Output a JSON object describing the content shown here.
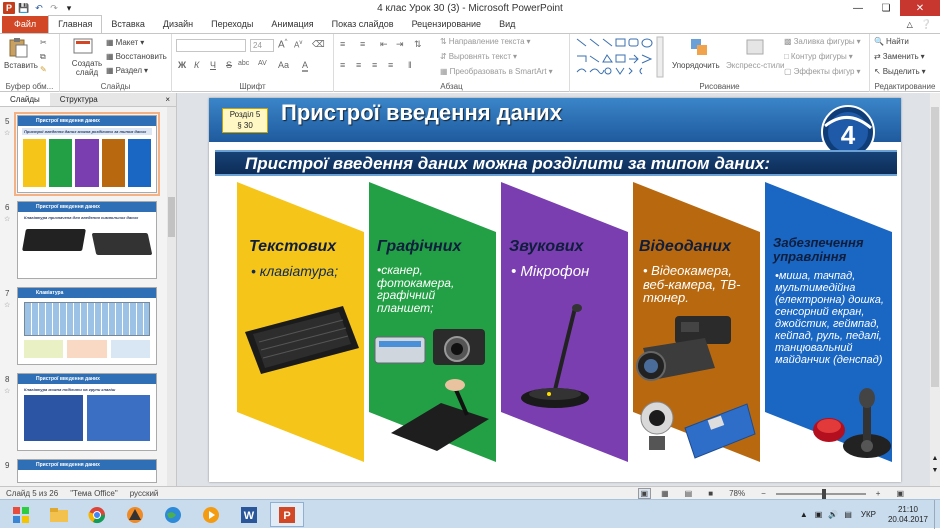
{
  "window": {
    "title": "4 клас Урок 30 (3)  -  Microsoft PowerPoint",
    "qat_logo": "P"
  },
  "tabs": [
    "Файл",
    "Главная",
    "Вставка",
    "Дизайн",
    "Переходы",
    "Анимация",
    "Показ слайдов",
    "Рецензирование",
    "Вид"
  ],
  "ribbon": {
    "clipboard": {
      "paste": "Вставить",
      "label": "Буфер обм..."
    },
    "slides": {
      "new_slide": "Создать слайд",
      "layout": "Макет",
      "reset": "Восстановить",
      "section": "Раздел",
      "label": "Слайды"
    },
    "font": {
      "size": "24",
      "label": "Шрифт",
      "bold": "Ж",
      "italic": "К",
      "underline": "Ч",
      "strike": "S",
      "shadow": "abc",
      "spacing": "AV",
      "case": "Aa",
      "color": "A"
    },
    "paragraph": {
      "text_dir": "Направление текста",
      "align": "Выровнять текст",
      "smartart": "Преобразовать в SmartArt",
      "label": "Абзац"
    },
    "drawing": {
      "arrange": "Упорядочить",
      "quick_styles": "Экспресс-стили",
      "fill": "Заливка фигуры",
      "outline": "Контур фигуры",
      "effects": "Эффекты фигур",
      "label": "Рисование"
    },
    "editing": {
      "find": "Найти",
      "replace": "Заменить",
      "select": "Выделить",
      "label": "Редактирование"
    }
  },
  "panel_tabs": {
    "slides": "Слайды",
    "outline": "Структура",
    "close": "×"
  },
  "thumbnails": [
    {
      "num": "5",
      "title": "Пристрої введення даних",
      "line": "Пристрої введення даних можна розділити за типом даних"
    },
    {
      "num": "6",
      "title": "Пристрої введення даних",
      "line": "Клавіатура призначена для введення символьних даних"
    },
    {
      "num": "7",
      "title": "Клавіатура",
      "line": ""
    },
    {
      "num": "8",
      "title": "Пристрої введення даних",
      "line": "Клавіатура можна поділити на групи клавіш"
    },
    {
      "num": "9",
      "title": "Пристрої введення даних",
      "line": ""
    }
  ],
  "slide": {
    "section_badge_line1": "Розділ 5",
    "section_badge_line2": "§ 30",
    "title": "Пристрої введення  даних",
    "grade": "4",
    "subtitle": "Пристрої введення даних можна розділити за типом даних:",
    "panels": [
      {
        "title": "Текстових",
        "text": "• клавіатура;",
        "color": "#f6c51a"
      },
      {
        "title": "Графічних",
        "text": "•сканер, фотокамера, графічний планшет;",
        "color": "#23a045"
      },
      {
        "title": "Звукових",
        "text": "• Мікрофон",
        "color": "#7a3eb1"
      },
      {
        "title": "Відеоданих",
        "text": "• Відеокамера, веб-камера, ТВ-тюнер.",
        "color": "#b8690f"
      },
      {
        "title": "Забезпечення управління",
        "text": "•миша, тачпад, мультимедійна (електронна) дошка, сенсорний екран, джойстик, геймпад, кейпад, руль, педалі, танцювальний майданчик (денспад)",
        "color": "#1a66c3"
      }
    ]
  },
  "status": {
    "slide_of": "Слайд 5 из 26",
    "theme": "\"Тема Office\"",
    "lang": "русский",
    "zoom": "78%"
  },
  "taskbar": {
    "lang": "УКР",
    "time": "21:10",
    "date": "20.04.2017"
  }
}
